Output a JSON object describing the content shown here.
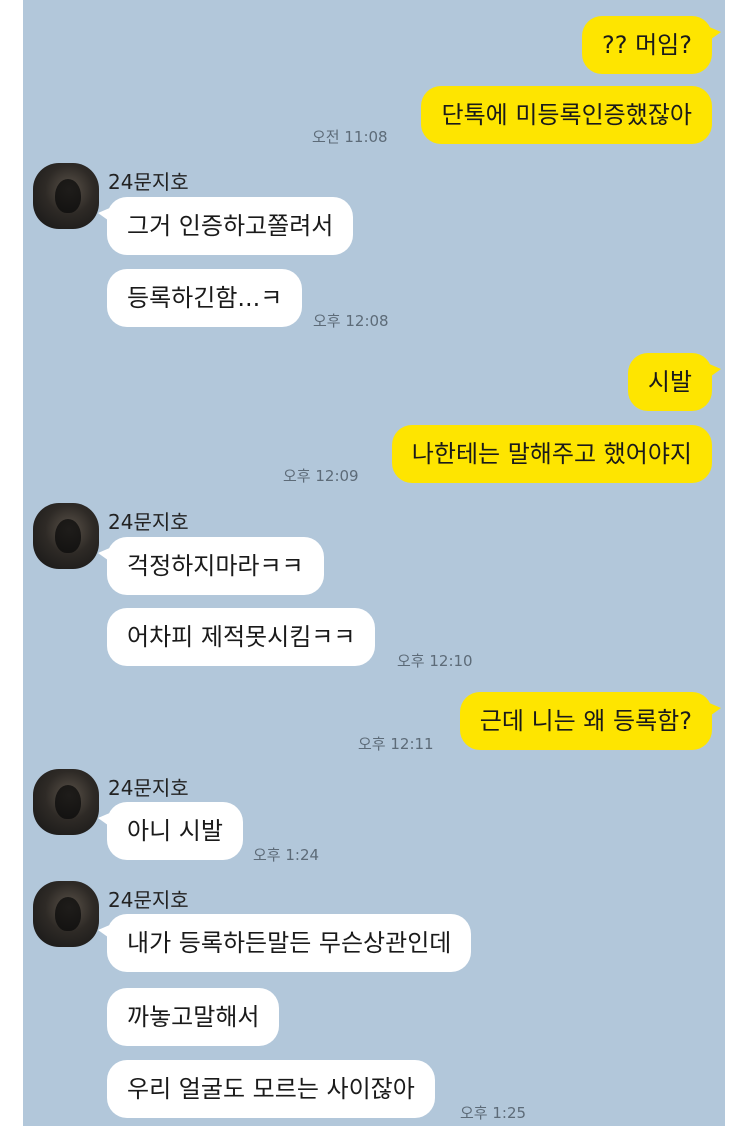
{
  "theme": {
    "chat_bg": "#b2c7da",
    "my_bubble": "#fee500",
    "their_bubble": "#ffffff"
  },
  "contact": {
    "name": "24문지호",
    "avatar_icon": "profile-photo"
  },
  "messages": [
    {
      "from": "me",
      "text": "?? 머임?"
    },
    {
      "from": "me",
      "text": "단톡에 미등록인증했잖아",
      "time": "오전 11:08"
    },
    {
      "from": "them",
      "text": "그거 인증하고쫄려서"
    },
    {
      "from": "them",
      "text": "등록하긴함...ㅋ",
      "time": "오후 12:08"
    },
    {
      "from": "me",
      "text": "시발"
    },
    {
      "from": "me",
      "text": "나한테는 말해주고 했어야지",
      "time": "오후 12:09"
    },
    {
      "from": "them",
      "text": "걱정하지마라ㅋㅋ"
    },
    {
      "from": "them",
      "text": "어차피 제적못시킴ㅋㅋ",
      "time": "오후 12:10"
    },
    {
      "from": "me",
      "text": "근데 니는 왜 등록함?",
      "time": "오후 12:11"
    },
    {
      "from": "them",
      "text": "아니 시발",
      "time": "오후 1:24"
    },
    {
      "from": "them",
      "text": "내가 등록하든말든 무슨상관인데"
    },
    {
      "from": "them",
      "text": "까놓고말해서"
    },
    {
      "from": "them",
      "text": "우리 얼굴도 모르는 사이잖아",
      "time": "오후 1:25"
    }
  ]
}
